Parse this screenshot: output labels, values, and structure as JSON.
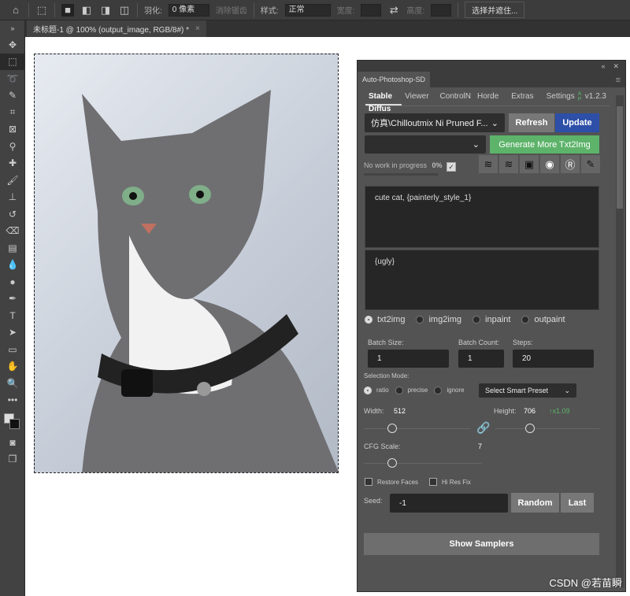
{
  "options_bar": {
    "feather_label": "羽化:",
    "feather_value": "0 像素",
    "antialias_label": "消除锯齿",
    "style_label": "样式:",
    "style_value": "正常",
    "width_label": "宽度:",
    "height_label": "高度:",
    "select_mask_button": "选择并遮住..."
  },
  "document_tab": {
    "title": "未标题-1 @ 100% (output_image, RGB/8#) *",
    "close": "×"
  },
  "panel": {
    "title": "Auto-Photoshop-SD",
    "tabs": [
      "Stable Diffus",
      "Viewer",
      "ControlN",
      "Horde",
      "Extras",
      "Settings"
    ],
    "version_badge": "A P",
    "version": "v1.2.3",
    "model_select": "仿真\\Chilloutmix Ni Pruned F...",
    "refresh_button": "Refresh",
    "update_button": "Update",
    "generate_button": "Generate More Txt2Img",
    "status": "No work in progress",
    "progress": "0%",
    "progress_value": 0,
    "prompt": "cute cat, {painterly_style_1}",
    "negative_prompt": "{ugly}",
    "modes": [
      {
        "label": "txt2img",
        "selected": true
      },
      {
        "label": "img2img",
        "selected": false
      },
      {
        "label": "inpaint",
        "selected": false
      },
      {
        "label": "outpaint",
        "selected": false
      }
    ],
    "batch_size_label": "Batch Size:",
    "batch_size": "1",
    "batch_count_label": "Batch Count:",
    "batch_count": "1",
    "steps_label": "Steps:",
    "steps": "20",
    "selection_mode_label": "Selection Mode:",
    "selection_modes": [
      {
        "label": "ratio",
        "selected": true
      },
      {
        "label": "precise",
        "selected": false
      },
      {
        "label": "ignore",
        "selected": false
      }
    ],
    "smart_preset": "Select Smart Preset",
    "width_label": "Width:",
    "width": "512",
    "height_label": "Height:",
    "height": "706",
    "ratio": "↑x1.09",
    "cfg_label": "CFG Scale:",
    "cfg": "7",
    "restore_faces": "Restore Faces",
    "hi_res_fix": "Hi Res Fix",
    "seed_label": "Seed:",
    "seed": "-1",
    "random_button": "Random",
    "last_button": "Last",
    "show_samplers_button": "Show Samplers",
    "colors": {
      "update": "#2d4fa8",
      "generate": "#5db36a",
      "ratio": "#5db36a"
    }
  },
  "watermark": "CSDN @若苗瞬"
}
